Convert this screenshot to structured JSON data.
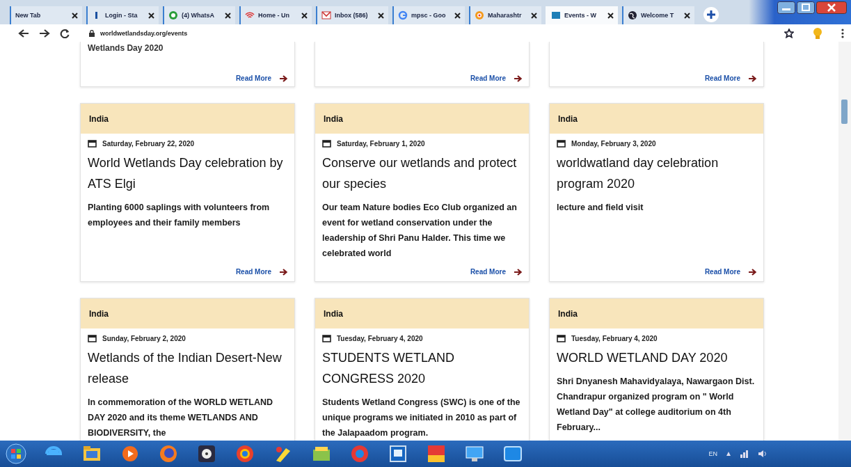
{
  "browser": {
    "tabs": [
      {
        "title": "New Tab",
        "selected": false
      },
      {
        "title": "Login - Sta",
        "selected": false
      },
      {
        "title": "(4) WhatsA",
        "selected": false
      },
      {
        "title": "Home - Un",
        "selected": false
      },
      {
        "title": "Inbox (586)",
        "selected": false
      },
      {
        "title": "mpsc - Goo",
        "selected": false
      },
      {
        "title": "Maharashtr",
        "selected": false
      },
      {
        "title": "Events - W",
        "selected": true
      },
      {
        "title": "Welcome T",
        "selected": false
      }
    ],
    "url": "worldwetlandsday.org/events"
  },
  "cards": [
    {
      "kind": "partial",
      "title": "Wetlands Day 2020",
      "link": "Read More"
    },
    {
      "kind": "partial",
      "link": "Read More"
    },
    {
      "kind": "partial",
      "link": "Read More"
    },
    {
      "kind": "full",
      "region": "India",
      "date": "Saturday, February 22, 2020",
      "title": "World Wetlands Day celebration by ATS Elgi",
      "description": "Planting 6000 saplings with volunteers from employees and their family members",
      "link": "Read More"
    },
    {
      "kind": "full",
      "region": "India",
      "date": "Saturday, February 1, 2020",
      "title": "Conserve our wetlands and protect our species",
      "description": "Our team Nature bodies Eco Club organized an event for wetland conservation under the leadership of Shri Panu Halder. This time we celebrated world",
      "link": "Read More"
    },
    {
      "kind": "full",
      "region": "India",
      "date": "Monday, February 3, 2020",
      "title": "worldwatland day celebration program 2020",
      "description": "lecture and field visit",
      "link": "Read More"
    },
    {
      "kind": "full",
      "region": "India",
      "date": "Sunday, February 2, 2020",
      "title": "Wetlands of the Indian Desert-New release",
      "description": "In commemoration of the WORLD WETLAND DAY 2020 and its theme WETLANDS AND BIODIVERSITY, the"
    },
    {
      "kind": "full",
      "region": "India",
      "date": "Tuesday, February 4, 2020",
      "title": "STUDENTS WETLAND CONGRESS 2020",
      "description": "Students Wetland Congress (SWC) is one of the unique programs we initiated in 2010 as part of the Jalapaadom program."
    },
    {
      "kind": "full",
      "region": "India",
      "date": "Tuesday, February 4, 2020",
      "title": "WORLD WETLAND DAY 2020",
      "description": "Shri Dnyanesh Mahavidyalaya, Nawargaon Dist. Chandrapur organized program on \" World Wetland Day\" at college auditorium on 4th February..."
    }
  ],
  "taskbar": {
    "language": "EN"
  }
}
